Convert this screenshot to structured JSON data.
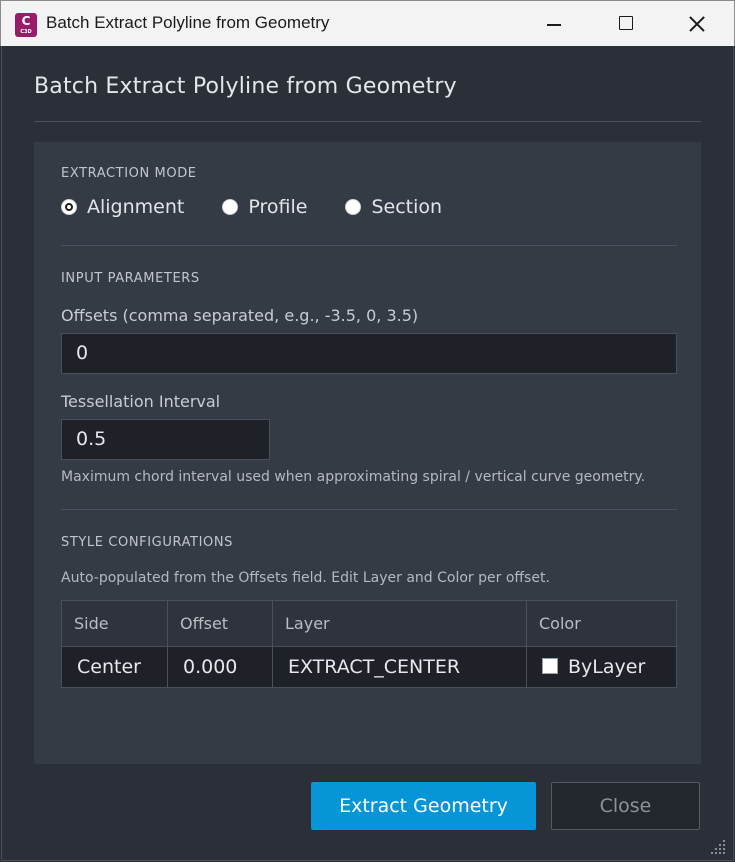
{
  "window": {
    "title": "Batch Extract Polyline from Geometry",
    "app_icon_letter": "C",
    "app_icon_sub": "C3D"
  },
  "header": {
    "title": "Batch Extract Polyline from Geometry"
  },
  "extraction_mode": {
    "label": "EXTRACTION MODE",
    "options": [
      {
        "label": "Alignment",
        "checked": true
      },
      {
        "label": "Profile",
        "checked": false
      },
      {
        "label": "Section",
        "checked": false
      }
    ]
  },
  "input_parameters": {
    "label": "INPUT PARAMETERS",
    "offsets_label": "Offsets (comma separated, e.g., -3.5, 0, 3.5)",
    "offsets_value": "0",
    "tessellation_label": "Tessellation Interval",
    "tessellation_value": "0.5",
    "hint": "Maximum chord interval used when approximating spiral / vertical curve geometry."
  },
  "style_configurations": {
    "label": "STYLE CONFIGURATIONS",
    "description": "Auto-populated from the Offsets field. Edit Layer and Color per offset.",
    "columns": [
      "Side",
      "Offset",
      "Layer",
      "Color"
    ],
    "rows": [
      {
        "side": "Center",
        "offset": "0.000",
        "layer": "EXTRACT_CENTER",
        "color": "ByLayer"
      }
    ]
  },
  "buttons": {
    "extract": "Extract Geometry",
    "close": "Close"
  },
  "colors": {
    "accent": "#0696d7",
    "background": "#2b2f37",
    "panel": "#353b45"
  }
}
